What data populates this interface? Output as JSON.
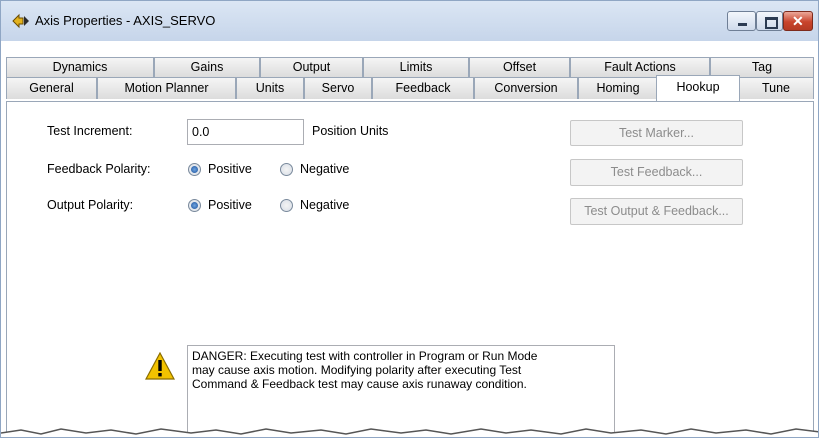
{
  "window": {
    "title": "Axis Properties - AXIS_SERVO"
  },
  "tabs": {
    "row1": [
      "Dynamics",
      "Gains",
      "Output",
      "Limits",
      "Offset",
      "Fault Actions",
      "Tag"
    ],
    "row2": [
      "General",
      "Motion Planner",
      "Units",
      "Servo",
      "Feedback",
      "Conversion",
      "Homing",
      "Hookup",
      "Tune"
    ],
    "selected": "Hookup"
  },
  "hookup": {
    "test_increment_label": "Test Increment:",
    "test_increment_value": "0.0",
    "position_units_label": "Position Units",
    "feedback_polarity_label": "Feedback Polarity:",
    "output_polarity_label": "Output Polarity:",
    "positive_label": "Positive",
    "negative_label": "Negative",
    "feedback_polarity_selected": "Positive",
    "output_polarity_selected": "Positive",
    "test_marker_button": "Test Marker...",
    "test_feedback_button": "Test Feedback...",
    "test_output_feedback_button": "Test Output & Feedback...",
    "danger_text_lines": [
      "DANGER: Executing test with controller in Program or Run Mode",
      "may cause axis motion. Modifying polarity after executing Test",
      "Command & Feedback test may cause axis runaway condition."
    ]
  },
  "icons": {
    "app": "axis-properties-icon",
    "warning": "warning-triangle-icon",
    "warning_color": "#f2c200"
  }
}
